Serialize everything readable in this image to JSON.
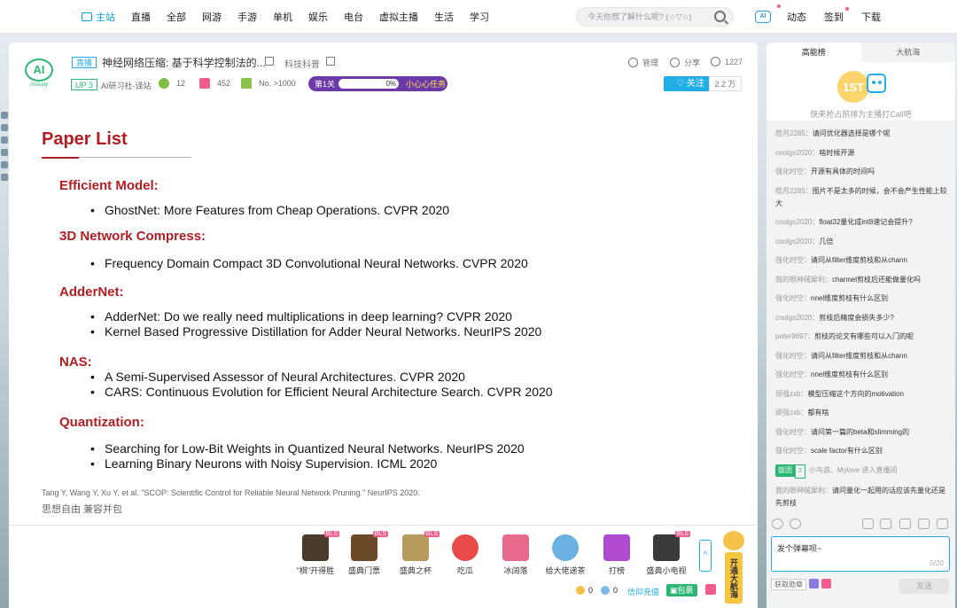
{
  "nav": {
    "items": [
      "主站",
      "直播",
      "全部",
      "网游",
      "手游",
      "单机",
      "娱乐",
      "电台",
      "虚拟主播",
      "生活",
      "学习"
    ],
    "search_placeholder": "今天你想了解什么呢? (☆▽☆)",
    "right": {
      "avatar_text": "AI",
      "dynamic": "动态",
      "checkin": "签到",
      "download": "下载"
    }
  },
  "room": {
    "logo_text": "AI",
    "logo_sub": "AIstudy",
    "live_tag": "直播",
    "title": "神经网络压缩: 基于科学控制法的...",
    "category": "科技科普",
    "up_level": "UP 3",
    "uname": "AI研习社-译站",
    "stat1": "12",
    "stat2": "452",
    "rank": "No. >1000",
    "mission_stage": "第1关",
    "mission_progress_text": "0%",
    "mission_progress": 0,
    "mission_task": "小心心任务",
    "manage": "管理",
    "share": "分享",
    "viewers": "1227",
    "follow": "关注",
    "fans": "2.2 万"
  },
  "slide": {
    "title": "Paper List",
    "sections": [
      {
        "heading": "Efficient Model:",
        "items": [
          "GhostNet: More Features from Cheap Operations. CVPR 2020"
        ]
      },
      {
        "heading": "3D Network Compress:",
        "items": [
          "Frequency Domain Compact 3D Convolutional Neural Networks. CVPR 2020"
        ]
      },
      {
        "heading": "AdderNet:",
        "items": [
          "AdderNet: Do we really need multiplications in deep learning? CVPR 2020",
          "Kernel Based Progressive Distillation for Adder Neural Networks. NeurIPS 2020"
        ]
      },
      {
        "heading": "NAS:",
        "items": [
          "A Semi-Supervised Assessor of Neural Architectures. CVPR 2020",
          "CARS: Continuous Evolution for Efficient Neural Architecture Search. CVPR 2020"
        ]
      },
      {
        "heading": "Quantization:",
        "items": [
          "Searching for Low-Bit Weights in Quantized Neural Networks. NeurIPS 2020",
          "Learning Binary Neurons with Noisy Supervision. ICML 2020"
        ]
      }
    ],
    "citation": "Tang Y, Wang Y, Xu Y, et al.  \"SCOP: Scientific Control for Reliable Neural Network Pruning.\" NeurIPS 2020.",
    "motto": "思想自由 兼容并包"
  },
  "gifts": [
    {
      "name": "\"棋\"开得胜",
      "bls": "BLS",
      "color": "#4a3b2a"
    },
    {
      "name": "盛典门票",
      "bls": "BLS",
      "color": "#6b4a2a"
    },
    {
      "name": "盛典之杯",
      "bls": "BLS",
      "color": "#b79b5e"
    },
    {
      "name": "吃瓜",
      "bls": "",
      "color": "#e84a4a"
    },
    {
      "name": "冰阔落",
      "bls": "",
      "color": "#e86a8a"
    },
    {
      "name": "给大佬递茶",
      "bls": "",
      "color": "#6ab0e0"
    },
    {
      "name": "打榜",
      "bls": "",
      "color": "#b04ad0"
    },
    {
      "name": "盛典小电视",
      "bls": "BLS",
      "color": "#3a3a3a"
    }
  ],
  "guard_text": "开通大航海",
  "wallet": {
    "gold": "0",
    "silver": "0",
    "recharge": "信仰充值",
    "package": "包裹"
  },
  "side": {
    "tabs": [
      "高能榜",
      "大航海"
    ],
    "rank_tip": "快来抢占前排为主播打Call吧",
    "rank_badge": "1ST",
    "messages": [
      {
        "user": "皓月2285：",
        "text": "请问优化器选择是哪个呢"
      },
      {
        "user": "coolgo2020：",
        "text": "啥时候开源"
      },
      {
        "user": "强化时空：",
        "text": "开源有具体的时间吗"
      },
      {
        "user": "皓月2285：",
        "text": "图片不是太多的时候，会不会产生性能上较大"
      },
      {
        "user": "coolgo2020：",
        "text": "float32量化成int8速记会提升?"
      },
      {
        "user": "coolgo2020：",
        "text": "几倍"
      },
      {
        "user": "强化时空：",
        "text": "请问从filter维度剪枝和从chann"
      },
      {
        "user": "我的眼神贼犀利：",
        "text": "channel剪枝后还能做量化吗"
      },
      {
        "user": "强化时空：",
        "text": "nnel维度剪枝有什么区别"
      },
      {
        "user": "coolgo2020：",
        "text": "剪枝后精度会损失多少?"
      },
      {
        "user": "peter9697：",
        "text": "剪枝的论文有哪些可以入门的呢"
      },
      {
        "user": "强化时空：",
        "text": "请问从filter维度剪枝和从chann"
      },
      {
        "user": "强化时空：",
        "text": "nnel维度剪枝有什么区别"
      },
      {
        "user": "顽强zxb：",
        "text": "模型压缩这个方向的motivation"
      },
      {
        "user": "顽强zxb：",
        "text": "都有啥"
      },
      {
        "user": "强化时空：",
        "text": "请问第一篇的beta和slimming的"
      },
      {
        "user": "强化时空：",
        "text": "scale factor有什么区别"
      }
    ],
    "system": {
      "medal": "饭团",
      "medal_level": "2",
      "text": "小鸟游、Mylove 进入直播间"
    },
    "last": {
      "user": "我的眼神贼犀利：",
      "text": "请问量化一起用的话应该先量化还是先剪枝"
    },
    "input_placeholder": "发个弹幕呗~",
    "input_count": "0/20",
    "medal_btn": "获取勋章",
    "send": "发送"
  },
  "colors": {
    "accent": "#23ade5",
    "brand_green": "#2bb673",
    "slide_red": "#b01e23",
    "pink": "#f25d8e"
  }
}
